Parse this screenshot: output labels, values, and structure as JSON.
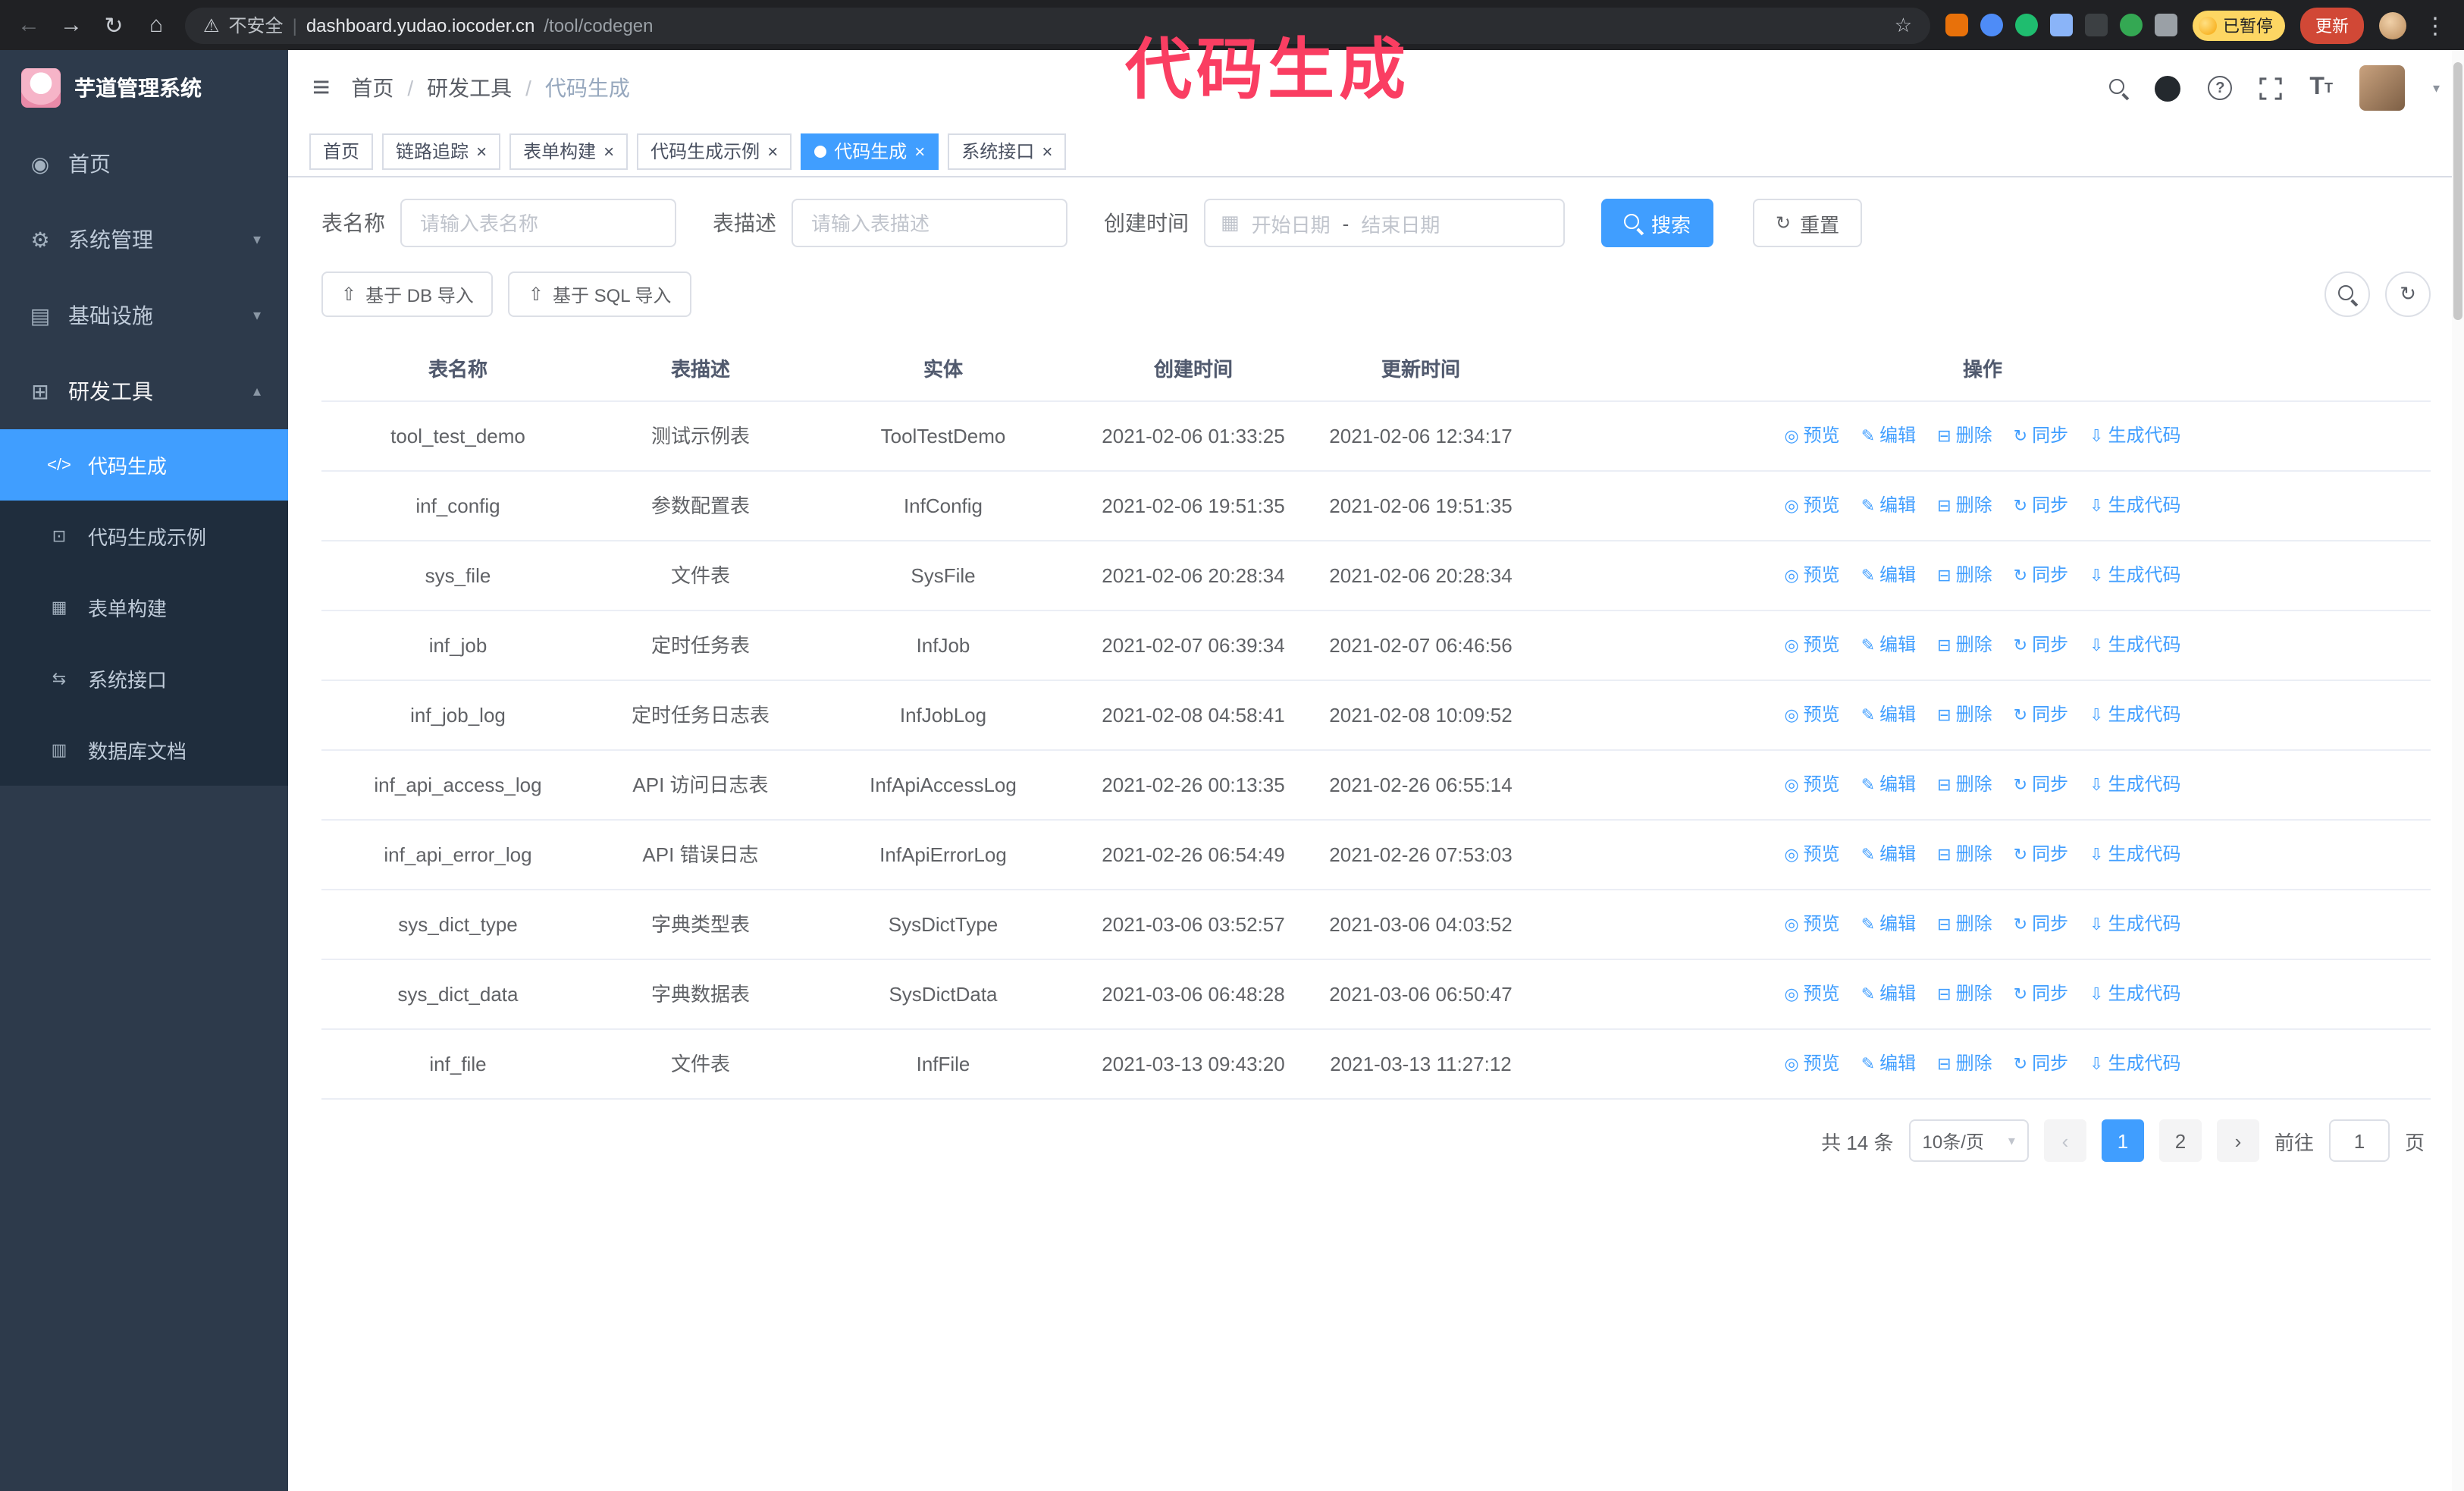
{
  "annotation": "代码生成",
  "browser": {
    "security_label": "不安全",
    "url_host": "dashboard.yudao.iocoder.cn",
    "url_path": "/tool/codegen",
    "paused_badge": "已暂停",
    "update_button": "更新"
  },
  "sidebar": {
    "logo_title": "芋道管理系统",
    "items": [
      {
        "label": "首页"
      },
      {
        "label": "系统管理"
      },
      {
        "label": "基础设施"
      },
      {
        "label": "研发工具"
      }
    ],
    "sub_items": [
      {
        "label": "代码生成",
        "active": true
      },
      {
        "label": "代码生成示例",
        "active": false
      },
      {
        "label": "表单构建",
        "active": false
      },
      {
        "label": "系统接口",
        "active": false
      },
      {
        "label": "数据库文档",
        "active": false
      }
    ]
  },
  "header": {
    "breadcrumb": [
      "首页",
      "研发工具",
      "代码生成"
    ]
  },
  "tabs": [
    {
      "label": "首页",
      "closable": false,
      "active": false
    },
    {
      "label": "链路追踪",
      "closable": true,
      "active": false
    },
    {
      "label": "表单构建",
      "closable": true,
      "active": false
    },
    {
      "label": "代码生成示例",
      "closable": true,
      "active": false
    },
    {
      "label": "代码生成",
      "closable": true,
      "active": true
    },
    {
      "label": "系统接口",
      "closable": true,
      "active": false
    }
  ],
  "filters": {
    "table_name_label": "表名称",
    "table_name_placeholder": "请输入表名称",
    "table_desc_label": "表描述",
    "table_desc_placeholder": "请输入表描述",
    "create_time_label": "创建时间",
    "start_date_placeholder": "开始日期",
    "range_separator": "-",
    "end_date_placeholder": "结束日期",
    "search_button": "搜索",
    "reset_button": "重置"
  },
  "toolbar": {
    "import_db_button": "基于 DB 导入",
    "import_sql_button": "基于 SQL 导入"
  },
  "table": {
    "columns": [
      "表名称",
      "表描述",
      "实体",
      "创建时间",
      "更新时间",
      "操作"
    ],
    "actions": [
      "预览",
      "编辑",
      "删除",
      "同步",
      "生成代码"
    ],
    "rows": [
      {
        "name": "tool_test_demo",
        "desc": "测试示例表",
        "entity": "ToolTestDemo",
        "created": "2021-02-06 01:33:25",
        "updated": "2021-02-06 12:34:17"
      },
      {
        "name": "inf_config",
        "desc": "参数配置表",
        "entity": "InfConfig",
        "created": "2021-02-06 19:51:35",
        "updated": "2021-02-06 19:51:35"
      },
      {
        "name": "sys_file",
        "desc": "文件表",
        "entity": "SysFile",
        "created": "2021-02-06 20:28:34",
        "updated": "2021-02-06 20:28:34"
      },
      {
        "name": "inf_job",
        "desc": "定时任务表",
        "entity": "InfJob",
        "created": "2021-02-07 06:39:34",
        "updated": "2021-02-07 06:46:56"
      },
      {
        "name": "inf_job_log",
        "desc": "定时任务日志表",
        "entity": "InfJobLog",
        "created": "2021-02-08 04:58:41",
        "updated": "2021-02-08 10:09:52"
      },
      {
        "name": "inf_api_access_log",
        "desc": "API 访问日志表",
        "entity": "InfApiAccessLog",
        "created": "2021-02-26 00:13:35",
        "updated": "2021-02-26 06:55:14"
      },
      {
        "name": "inf_api_error_log",
        "desc": "API 错误日志",
        "entity": "InfApiErrorLog",
        "created": "2021-02-26 06:54:49",
        "updated": "2021-02-26 07:53:03"
      },
      {
        "name": "sys_dict_type",
        "desc": "字典类型表",
        "entity": "SysDictType",
        "created": "2021-03-06 03:52:57",
        "updated": "2021-03-06 04:03:52"
      },
      {
        "name": "sys_dict_data",
        "desc": "字典数据表",
        "entity": "SysDictData",
        "created": "2021-03-06 06:48:28",
        "updated": "2021-03-06 06:50:47"
      },
      {
        "name": "inf_file",
        "desc": "文件表",
        "entity": "InfFile",
        "created": "2021-03-13 09:43:20",
        "updated": "2021-03-13 11:27:12"
      }
    ]
  },
  "pagination": {
    "total": "共 14 条",
    "page_size": "10条/页",
    "pages": [
      "1",
      "2"
    ],
    "active_page": "1",
    "goto_label": "前往",
    "goto_value": "1",
    "goto_suffix": "页"
  },
  "icons": {
    "back": "←",
    "forward": "→",
    "reload": "↻",
    "home": "⌂",
    "warning": "⚠",
    "divider": "|",
    "star": "☆",
    "kebab": "⋮",
    "hamburger": "≡",
    "breadcrumb_sep": "/",
    "chevron_down": "▾",
    "chevron_up": "▴",
    "caret_down": "▾",
    "menu_home": "◉",
    "menu_system": "⚙",
    "menu_infra": "▤",
    "menu_dev": "⊞",
    "sub_codegen": "</>",
    "sub_example": "⊡",
    "sub_form": "▦",
    "sub_api": "⇆",
    "sub_db": "▥",
    "calendar": "▦",
    "refresh": "↻",
    "upload": "⇧",
    "close": "×",
    "question": "?",
    "fontsize_big": "T",
    "fontsize_small": "T",
    "prev": "‹",
    "next": "›",
    "action_glyphs": [
      "◎",
      "✎",
      "⊟",
      "↻",
      "⇩"
    ]
  }
}
